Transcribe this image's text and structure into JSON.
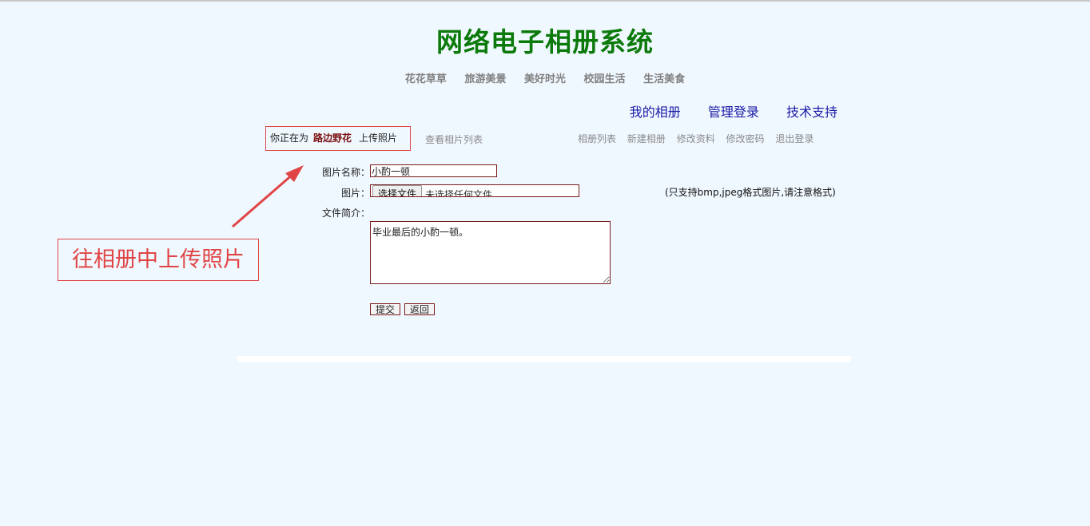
{
  "site": {
    "title": "网络电子相册系统"
  },
  "categories": [
    "花花草草",
    "旅游美景",
    "美好时光",
    "校园生活",
    "生活美食"
  ],
  "top_links": [
    "我的相册",
    "管理登录",
    "技术支持"
  ],
  "context": {
    "prefix": "你正在为",
    "album_name": "路边野花",
    "action": "上传照片",
    "view_list": "查看相片列表"
  },
  "album_nav": [
    "相册列表",
    "新建相册",
    "修改资料",
    "修改密码",
    "退出登录"
  ],
  "form": {
    "name_label": "图片名称：",
    "name_value": "小酌一顿",
    "image_label": "图片：",
    "file_button": "选择文件",
    "file_status": "未选择任何文件",
    "format_note": "(只支持bmp,jpeg格式图片,请注意格式)",
    "desc_label": "文件简介：",
    "desc_value": "毕业最后的小酌一顿。",
    "submit": "提交",
    "back": "返回"
  },
  "annotation": {
    "text": "往相册中上传照片"
  },
  "colors": {
    "background": "#f0f8ff",
    "title": "#0b7a0b",
    "link": "#1a1aa6",
    "annotation": "#e04545",
    "album_name": "#7a1010"
  }
}
